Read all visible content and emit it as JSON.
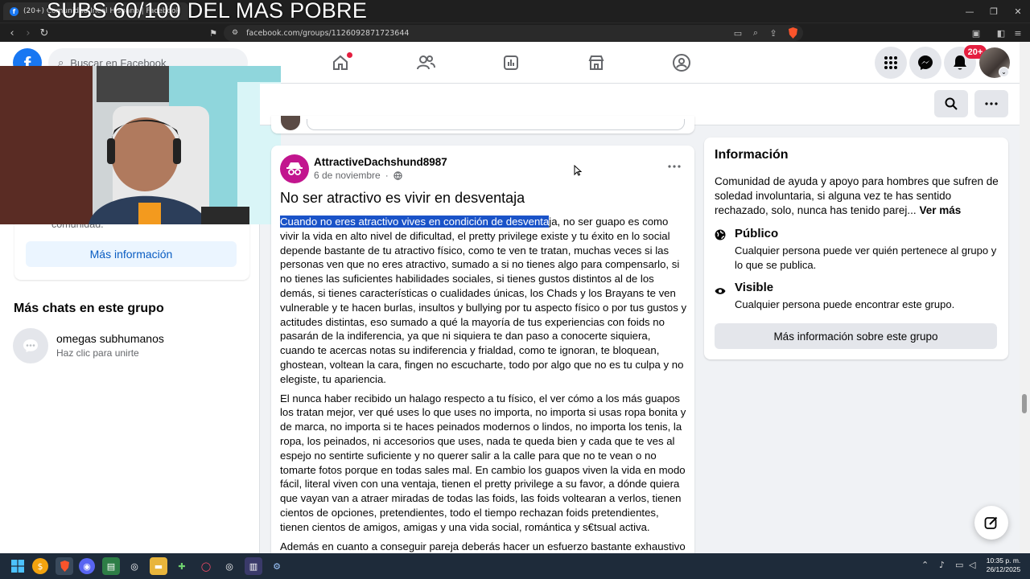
{
  "overlay": {
    "text": "SUBS 60/100 DEL MAS POBRE"
  },
  "browser": {
    "tab_title": "(20+) Comunidad Incel Hispano | Facebook",
    "url": "facebook.com/groups/1126092871723644"
  },
  "fb_nav": {
    "search_placeholder": "Buscar en Facebook",
    "notifications_badge": "20+"
  },
  "left_panel": {
    "partial_text": "comunidad.",
    "more_info_button": "Más información",
    "chats_heading": "Más chats en este grupo",
    "chat_item": {
      "name": "omegas subhumanos",
      "subtitle": "Haz clic para unirte"
    }
  },
  "post": {
    "author": "AttractiveDachshund8987",
    "date": "6 de noviembre",
    "title": "No ser atractivo es vivir en desventaja",
    "selected_text": "Cuando no eres atractivo vives en condición de desventa",
    "paragraph1_rest": "ja, no ser guapo es como vivir la vida en alto nivel de dificultad, el pretty privilege existe y tu éxito en lo social depende bastante de tu atractivo físico, como te ven te tratan, muchas veces si las personas ven que no eres atractivo, sumado a si no tienes algo para compensarlo, si no tienes las suficientes habilidades sociales, si tienes gustos distintos al de los demás, si tienes características o cualidades únicas, los Chads y los Brayans te ven vulnerable y te hacen burlas, insultos y bullying por tu aspecto físico o por tus gustos y actitudes distintas, eso sumado a qué la mayoría de tus experiencias con foids no pasarán de la indiferencia, ya que ni siquiera te dan paso a conocerte siquiera, cuando te acercas notas su indiferencia y frialdad, como te ignoran, te bloquean, ghostean, voltean la cara, fingen no escucharte, todo por algo que no es tu culpa y no elegiste, tu apariencia.",
    "paragraph2": "El nunca haber recibido un halago respecto a tu físico, el ver cómo a los más guapos los tratan mejor, ver qué uses lo que uses no importa, no importa si usas ropa bonita y de marca, no importa si te haces peinados modernos o lindos, no importa los tenis, la ropa, los peinados, ni accesorios que uses, nada te queda bien y cada que te ves al espejo no sentirte suficiente y no querer salir a la calle para que no te vean o no tomarte fotos porque en todas sales mal. En cambio los guapos viven la vida en modo fácil, literal viven con una ventaja, tienen el pretty privilege a su favor, a dónde quiera que vayan van a atraer miradas de todas las foids, las foids voltearan a verlos, tienen cientos de opciones, pretendientes, todo el tiempo rechazan foids pretendientes, tienen cientos de amigos, amigas y una vida social, romántica y s€tsual activa.",
    "paragraph3_partial": "Además en cuanto a conseguir pareja deberás hacer un esfuerzo bastante exhaustivo"
  },
  "info": {
    "heading": "Información",
    "description": "Comunidad de ayuda y apoyo para hombres que sufren de soledad involuntaria, si alguna vez te has sentido rechazado, solo, nunca has tenido parej...",
    "see_more": "Ver más",
    "public_title": "Público",
    "public_desc": "Cualquier persona puede ver quién pertenece al grupo y lo que se publica.",
    "visible_title": "Visible",
    "visible_desc": "Cualquier persona puede encontrar este grupo.",
    "more_button": "Más información sobre este grupo"
  },
  "taskbar": {
    "time": "10:35 p. m.",
    "date": "26/12/2025"
  },
  "colors": {
    "fb_blue": "#1877f2",
    "selection": "#1a53c8",
    "badge_red": "#e41e3f"
  }
}
